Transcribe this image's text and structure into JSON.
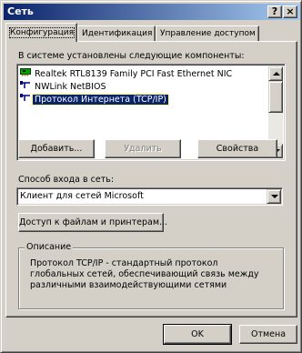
{
  "window": {
    "title": "Сеть",
    "help_button": "?",
    "close_button": "×"
  },
  "tabs": [
    {
      "label": "Конфигурация"
    },
    {
      "label": "Идентификация"
    },
    {
      "label": "Управление доступом"
    }
  ],
  "components": {
    "label": "В системе установлены следующие компоненты:",
    "items": [
      {
        "label": "Realtek RTL8139 Family PCI Fast Ethernet NIC",
        "icon": "network-card-icon",
        "icon_color": "#008000"
      },
      {
        "label": "NWLink NetBIOS",
        "icon": "protocol-icon",
        "icon_color": "#000080"
      },
      {
        "label": "Протокол Интернета (TCP/IP)",
        "icon": "protocol-icon",
        "icon_color": "#000080",
        "selected": true
      }
    ]
  },
  "buttons": {
    "add": "Добавить...",
    "remove": "Удалить",
    "properties": "Свойства",
    "file_print_sharing": "Доступ к файлам и принтерам...",
    "ok": "OK",
    "cancel": "Отмена"
  },
  "logon": {
    "label": "Способ входа в сеть:",
    "selected": "Клиент для сетей Microsoft"
  },
  "description": {
    "legend": "Описание",
    "text": "Протокол TCP/IP - стандартный протокол глобальных сетей, обеспечивающий связь между различными взаимодействующими сетями"
  },
  "colors": {
    "face": "#d4d0c8",
    "titlebar_start": "#0a246a",
    "titlebar_end": "#a6caf0",
    "selection": "#0a246a"
  }
}
